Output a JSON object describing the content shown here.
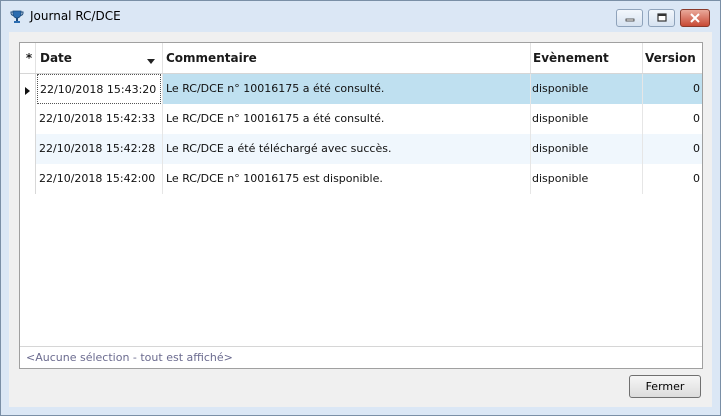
{
  "window": {
    "title": "Journal RC/DCE"
  },
  "table": {
    "columns": {
      "star": "*",
      "date": "Date",
      "commentaire": "Commentaire",
      "evenement": "Evènement",
      "version": "Version"
    },
    "rows": [
      {
        "date": "22/10/2018 15:43:20",
        "commentaire": "Le RC/DCE n° 10016175 a été consulté.",
        "evenement": "disponible",
        "version": "0"
      },
      {
        "date": "22/10/2018 15:42:33",
        "commentaire": "Le RC/DCE n° 10016175 a été consulté.",
        "evenement": "disponible",
        "version": "0"
      },
      {
        "date": "22/10/2018 15:42:28",
        "commentaire": "Le RC/DCE a été téléchargé avec succès.",
        "evenement": "disponible",
        "version": "0"
      },
      {
        "date": "22/10/2018 15:42:00",
        "commentaire": "Le RC/DCE n° 10016175 est disponible.",
        "evenement": "disponible",
        "version": "0"
      }
    ]
  },
  "status": {
    "text": "<Aucune sélection - tout est affiché>"
  },
  "footer": {
    "close_label": "Fermer"
  },
  "colors": {
    "selected_row": "#bfe0f0",
    "alt_row": "#f0f7fd",
    "title_bg": "#dbe7f5",
    "close_btn": "#c84a35"
  },
  "icons": [
    "trophy-icon",
    "minimize-icon",
    "maximize-icon",
    "close-icon",
    "sort-desc-icon",
    "row-pointer-icon"
  ]
}
